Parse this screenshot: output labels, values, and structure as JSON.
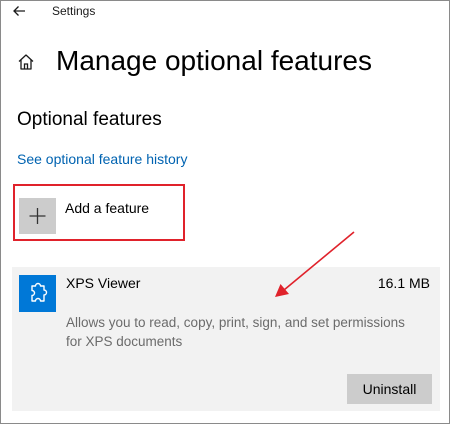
{
  "window": {
    "app_title": "Settings"
  },
  "page": {
    "title": "Manage optional features"
  },
  "section": {
    "title": "Optional features",
    "history_link": "See optional feature history"
  },
  "add_feature": {
    "label": "Add a feature",
    "icon": "plus-icon"
  },
  "features": [
    {
      "name": "XPS Viewer",
      "size": "16.1 MB",
      "description": "Allows you to read, copy, print, sign, and set permissions for XPS documents",
      "button_label": "Uninstall",
      "icon": "puzzle-icon"
    }
  ],
  "colors": {
    "accent": "#0078d7",
    "link": "#0063b1",
    "highlight": "#e0222b",
    "card_background": "#f2f2f2",
    "button_background": "#cccccc"
  }
}
